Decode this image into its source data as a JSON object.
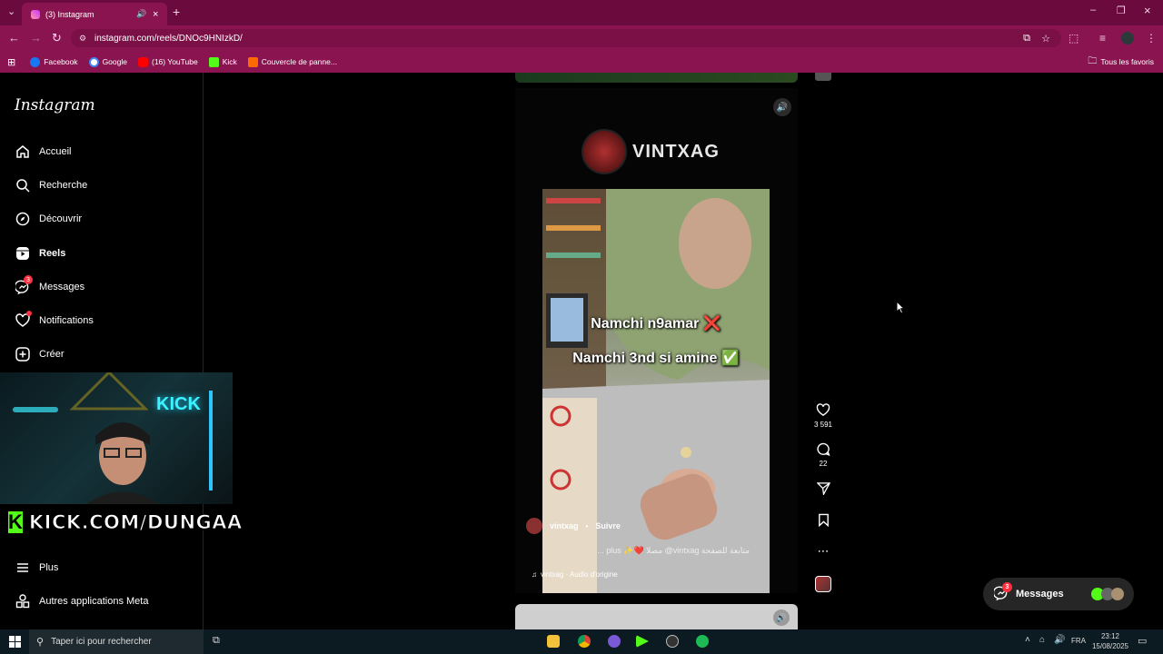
{
  "browser": {
    "tab_count_title": "(3) Instagram",
    "url": "instagram.com/reels/DNOc9HNIzkD/",
    "bookmarks": [
      "Facebook",
      "Google",
      "(16) YouTube",
      "Kick",
      "Couvercle de panne..."
    ],
    "all_favorites": "Tous les favoris"
  },
  "sidebar": {
    "logo": "Instagram",
    "items": [
      {
        "label": "Accueil",
        "icon": "home-icon"
      },
      {
        "label": "Recherche",
        "icon": "search-icon"
      },
      {
        "label": "Découvrir",
        "icon": "compass-icon"
      },
      {
        "label": "Reels",
        "icon": "reels-icon"
      },
      {
        "label": "Messages",
        "icon": "messenger-icon",
        "badge": "3"
      },
      {
        "label": "Notifications",
        "icon": "heart-icon"
      },
      {
        "label": "Créer",
        "icon": "plus-square-icon"
      }
    ],
    "more": "Plus",
    "meta_apps": "Autres applications Meta"
  },
  "overlay": {
    "kick_logo": "K",
    "kick_banner": "KICK.COM/DUNGAA",
    "webcam_sign": "KICK"
  },
  "reel": {
    "brand_name": "VINTXAG",
    "caption_line1": "Namchi n9amar ❌",
    "caption_line2": "Namchi 3nd si amine ✅",
    "author": "vintxag",
    "follow": "Suivre",
    "description": "... plus ✨❤️ مصلا @vintxag متابعة للصفحة",
    "audio": "vintxag · Audio d'origine",
    "likes": "3 591",
    "comments": "22"
  },
  "messages_pill": {
    "label": "Messages",
    "badge": "3"
  },
  "taskbar": {
    "search_placeholder": "Taper ici pour rechercher",
    "language": "FRA",
    "time": "23:12",
    "date": "15/08/2025"
  },
  "colors": {
    "chrome_dark": "#6b0a3d",
    "chrome": "#8a1450",
    "badge_red": "#ff3040",
    "kick_green": "#53fc18"
  }
}
